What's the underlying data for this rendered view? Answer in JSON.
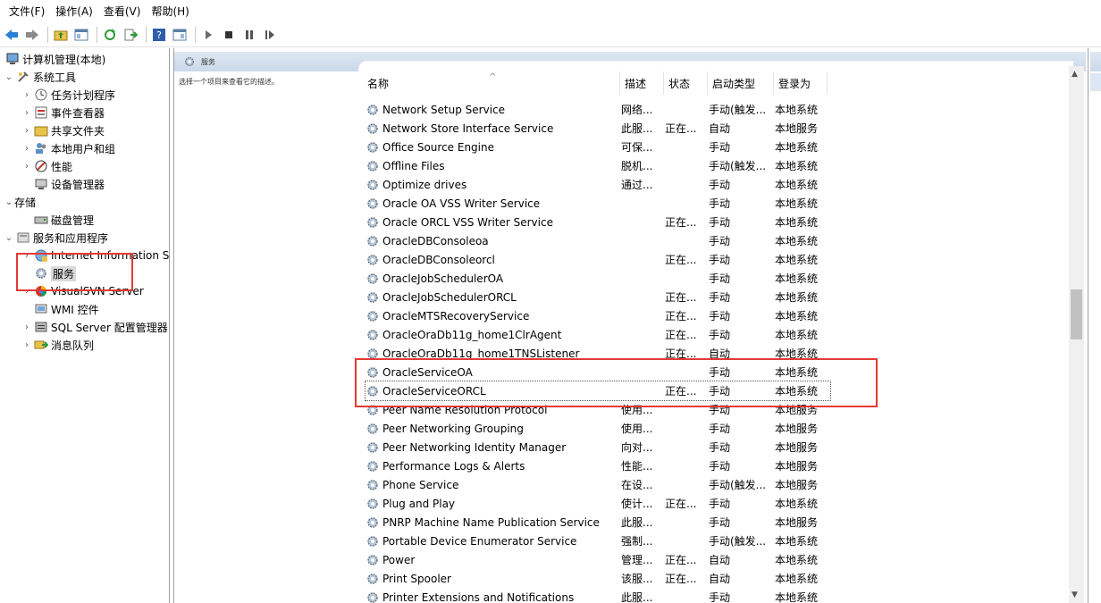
{
  "menu": [
    "文件(F)",
    "操作(A)",
    "查看(V)",
    "帮助(H)"
  ],
  "tree": {
    "root": "计算机管理(本地)",
    "system_tools": "系统工具",
    "task_scheduler": "任务计划程序",
    "event_viewer": "事件查看器",
    "shared_folders": "共享文件夹",
    "local_users": "本地用户和组",
    "performance": "性能",
    "device_manager": "设备管理器",
    "storage": "存储",
    "disk_management": "磁盘管理",
    "services_apps": "服务和应用程序",
    "iis": "Internet Information S",
    "services": "服务",
    "visualsvn": "VisualSVN Server",
    "wmi": "WMI 控件",
    "sql_config": "SQL Server 配置管理器",
    "message_queue": "消息队列"
  },
  "panel": {
    "title": "服务",
    "description": "选择一个项目来查看它的描述。"
  },
  "columns": {
    "name": "名称",
    "desc": "描述",
    "status": "状态",
    "startup": "启动类型",
    "logon": "登录为"
  },
  "services": [
    {
      "name": "Network Setup Service",
      "desc": "网络...",
      "status": "",
      "startup": "手动(触发...",
      "logon": "本地系统"
    },
    {
      "name": "Network Store Interface Service",
      "desc": "此服...",
      "status": "正在...",
      "startup": "自动",
      "logon": "本地服务"
    },
    {
      "name": "Office Source Engine",
      "desc": "可保...",
      "status": "",
      "startup": "手动",
      "logon": "本地系统"
    },
    {
      "name": "Offline Files",
      "desc": "脱机...",
      "status": "",
      "startup": "手动(触发...",
      "logon": "本地系统"
    },
    {
      "name": "Optimize drives",
      "desc": "通过...",
      "status": "",
      "startup": "手动",
      "logon": "本地系统"
    },
    {
      "name": "Oracle OA VSS Writer Service",
      "desc": "",
      "status": "",
      "startup": "手动",
      "logon": "本地系统"
    },
    {
      "name": "Oracle ORCL VSS Writer Service",
      "desc": "",
      "status": "正在...",
      "startup": "手动",
      "logon": "本地系统"
    },
    {
      "name": "OracleDBConsoleoa",
      "desc": "",
      "status": "",
      "startup": "手动",
      "logon": "本地系统"
    },
    {
      "name": "OracleDBConsoleorcl",
      "desc": "",
      "status": "正在...",
      "startup": "手动",
      "logon": "本地系统"
    },
    {
      "name": "OracleJobSchedulerOA",
      "desc": "",
      "status": "",
      "startup": "手动",
      "logon": "本地系统"
    },
    {
      "name": "OracleJobSchedulerORCL",
      "desc": "",
      "status": "正在...",
      "startup": "手动",
      "logon": "本地系统"
    },
    {
      "name": "OracleMTSRecoveryService",
      "desc": "",
      "status": "正在...",
      "startup": "手动",
      "logon": "本地系统"
    },
    {
      "name": "OracleOraDb11g_home1ClrAgent",
      "desc": "",
      "status": "正在...",
      "startup": "手动",
      "logon": "本地系统"
    },
    {
      "name": "OracleOraDb11g_home1TNSListener",
      "desc": "",
      "status": "正在...",
      "startup": "自动",
      "logon": "本地系统"
    },
    {
      "name": "OracleServiceOA",
      "desc": "",
      "status": "",
      "startup": "手动",
      "logon": "本地系统"
    },
    {
      "name": "OracleServiceORCL",
      "desc": "",
      "status": "正在...",
      "startup": "手动",
      "logon": "本地系统"
    },
    {
      "name": "Peer Name Resolution Protocol",
      "desc": "使用...",
      "status": "",
      "startup": "手动",
      "logon": "本地服务"
    },
    {
      "name": "Peer Networking Grouping",
      "desc": "使用...",
      "status": "",
      "startup": "手动",
      "logon": "本地服务"
    },
    {
      "name": "Peer Networking Identity Manager",
      "desc": "向对...",
      "status": "",
      "startup": "手动",
      "logon": "本地服务"
    },
    {
      "name": "Performance Logs & Alerts",
      "desc": "性能...",
      "status": "",
      "startup": "手动",
      "logon": "本地服务"
    },
    {
      "name": "Phone Service",
      "desc": "在设...",
      "status": "",
      "startup": "手动(触发...",
      "logon": "本地服务"
    },
    {
      "name": "Plug and Play",
      "desc": "使计...",
      "status": "正在...",
      "startup": "手动",
      "logon": "本地系统"
    },
    {
      "name": "PNRP Machine Name Publication Service",
      "desc": "此服...",
      "status": "",
      "startup": "手动",
      "logon": "本地服务"
    },
    {
      "name": "Portable Device Enumerator Service",
      "desc": "强制...",
      "status": "",
      "startup": "手动(触发...",
      "logon": "本地系统"
    },
    {
      "name": "Power",
      "desc": "管理...",
      "status": "正在...",
      "startup": "自动",
      "logon": "本地系统"
    },
    {
      "name": "Print Spooler",
      "desc": "该服...",
      "status": "正在...",
      "startup": "自动",
      "logon": "本地系统"
    },
    {
      "name": "Printer Extensions and Notifications",
      "desc": "此服...",
      "status": "",
      "startup": "手动",
      "logon": "本地系统"
    }
  ],
  "colors": {
    "highlight_box": "#e53935",
    "header_gradient": "#c9d8ea"
  }
}
